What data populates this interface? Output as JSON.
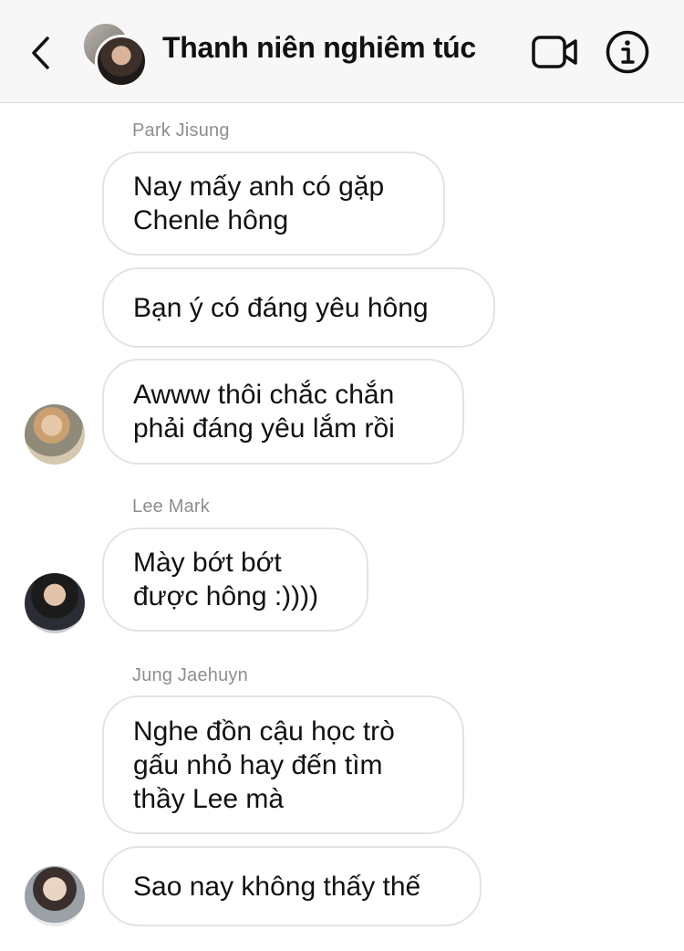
{
  "header": {
    "title": "Thanh niên nghiêm túc",
    "icons": {
      "back": "chevron-left-icon",
      "video": "video-call-icon",
      "info": "info-icon"
    }
  },
  "messages": [
    {
      "sender": "Park Jisung"
    },
    {
      "text": "Nay mấy anh có gặp\nChenle hông"
    },
    {
      "text": "Bạn ý có đáng yêu hông"
    },
    {
      "text": "Awww thôi chắc chắn\nphải đáng yêu lắm rồi"
    },
    {
      "sender": "Lee Mark"
    },
    {
      "text": "Mày bớt bớt\nđược hông :))))"
    },
    {
      "sender": "Jung Jaehuyn"
    },
    {
      "text": "Nghe đồn cậu học trò\ngấu nhỏ hay đến tìm\nthầy Lee mà"
    },
    {
      "text": "Sao nay không thấy thế"
    }
  ],
  "colors": {
    "header_bg": "#f7f7f7",
    "bubble_border": "#e3e3e3",
    "sender_text": "#8e8e8e",
    "text": "#111111"
  }
}
